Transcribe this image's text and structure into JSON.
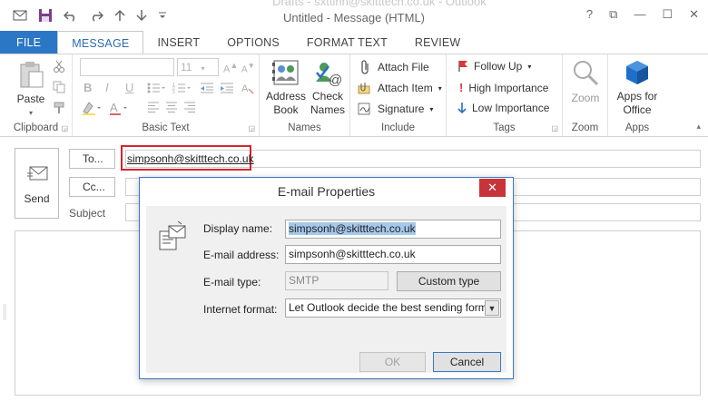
{
  "window": {
    "title": "Untitled - Message (HTML)",
    "background_title": "Drafts - sxttinn@skitttech.co.uk - Outlook",
    "controls": {
      "help": "?",
      "restore": "⧉",
      "minimize": "—",
      "maximize": "☐",
      "close": "✕"
    }
  },
  "qat": {
    "save_icon": "save-icon",
    "undo_icon": "undo-icon",
    "redo_icon": "redo-icon",
    "up_icon": "arrow-up-icon",
    "down_icon": "arrow-down-icon",
    "customize_icon": "customize-icon"
  },
  "tabs": [
    {
      "label": "FILE"
    },
    {
      "label": "MESSAGE"
    },
    {
      "label": "INSERT"
    },
    {
      "label": "OPTIONS"
    },
    {
      "label": "FORMAT TEXT"
    },
    {
      "label": "REVIEW"
    }
  ],
  "ribbon": {
    "clipboard": {
      "label": "Clipboard",
      "paste": "Paste"
    },
    "basic_text": {
      "label": "Basic Text",
      "font_size": "11",
      "bold": "B",
      "italic": "I",
      "underline": "U"
    },
    "names": {
      "label": "Names",
      "address_book": [
        "Address",
        "Book"
      ],
      "check_names": [
        "Check",
        "Names"
      ]
    },
    "include": {
      "label": "Include",
      "attach_file": "Attach File",
      "attach_item": "Attach Item",
      "signature": "Signature"
    },
    "tags": {
      "label": "Tags",
      "follow_up": "Follow Up",
      "high_importance": "High Importance",
      "low_importance": "Low Importance"
    },
    "zoom": {
      "label": "Zoom",
      "zoom": "Zoom"
    },
    "apps": {
      "label": "Apps",
      "apps_for_office": [
        "Apps for",
        "Office"
      ]
    }
  },
  "compose": {
    "send": "Send",
    "to_button": "To...",
    "cc_button": "Cc...",
    "subject_label": "Subject",
    "to_value": "simpsonh@skitttech.co.uk"
  },
  "dialog": {
    "title": "E-mail Properties",
    "display_name_label": "Display name:",
    "display_name_value": "simpsonh@skitttech.co.uk",
    "email_address_label": "E-mail address:",
    "email_address_value": "simpsonh@skitttech.co.uk",
    "email_type_label": "E-mail type:",
    "email_type_value": "SMTP",
    "custom_type_button": "Custom type",
    "internet_format_label": "Internet format:",
    "internet_format_value": "Let Outlook decide the best sending format",
    "ok_button": "OK",
    "cancel_button": "Cancel",
    "close": "✕"
  },
  "colors": {
    "file_tab": "#2b77c5",
    "highlight": "#d4262c",
    "dialog_border": "#3b78c7",
    "close_button": "#c7343a"
  }
}
